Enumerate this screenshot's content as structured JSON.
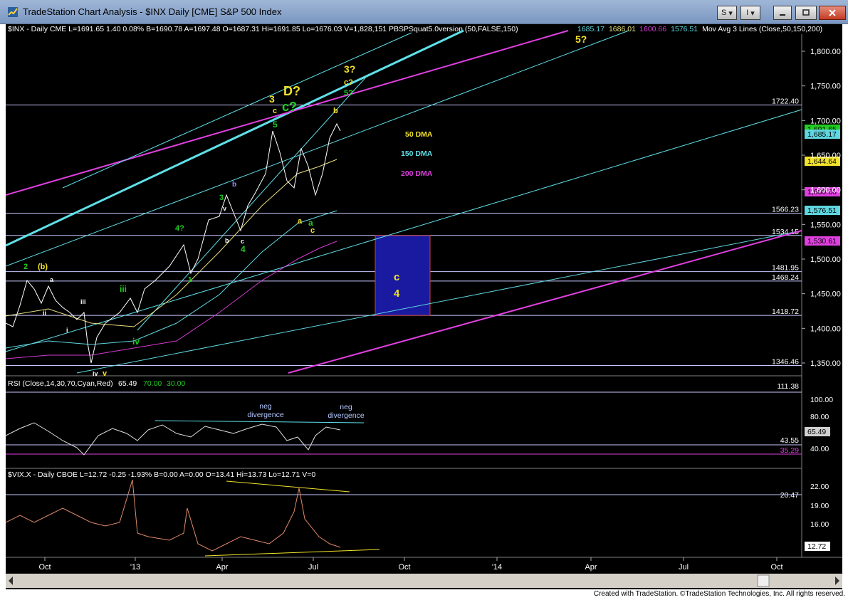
{
  "window": {
    "title": "TradeStation Chart Analysis - $INX Daily [CME] S&P 500 Index",
    "buttons": {
      "s": "S",
      "i": "I"
    }
  },
  "colors": {
    "price": "#ffffff",
    "ma50": "#e8e080",
    "ma150": "#5fd6e0",
    "ma200": "#d23bd2",
    "rsi": "#e0e0e0",
    "vix": "#e08a6a",
    "green": "#22cc22",
    "yellow": "#f2e22a",
    "cyan": "#5fe0e8",
    "magenta": "#e040e0",
    "box": "#1a1aa0"
  },
  "price_pane": {
    "header": "$INX - Daily  CME  L=1691.65  1.40  0.08%  B=1690.78  A=1697.48  O=1687.31  Hi=1691.85  Lo=1676.03  V=1,828,151  PBSPSquat5.0version (50,FALSE,150)",
    "header_extra": [
      {
        "text": "1685.17",
        "color": "#5fd6e0"
      },
      {
        "text": "1686.01",
        "color": "#e8e080"
      },
      {
        "text": "1600.66",
        "color": "#d23bd2"
      },
      {
        "text": "1576.51",
        "color": "#5fd6e0"
      },
      {
        "text": "Mov Avg 3 Lines (Close,50,150,200)",
        "color": "#ffffff"
      }
    ],
    "axis_ticks": [
      "1,800.00",
      "1,750.00",
      "1,700.00",
      "1,650.00",
      "1,600.00",
      "1,550.00",
      "1,500.00",
      "1,450.00",
      "1,400.00",
      "1,350.00"
    ],
    "level_lines": [
      {
        "label": "1722.40"
      },
      {
        "label": "1566.23"
      },
      {
        "label": "1534.15"
      },
      {
        "label": "1481.95"
      },
      {
        "label": "1468.24"
      },
      {
        "label": "1418.72"
      },
      {
        "label": "1346.46"
      }
    ],
    "tags": [
      {
        "text": "1,691.65",
        "bg": "#22cc22"
      },
      {
        "text": "1,685.17",
        "bg": "#5fd6e0"
      },
      {
        "text": "1,644.64",
        "bg": "#f2e22a"
      },
      {
        "text": "1,600.66",
        "bg": "#e040e0"
      },
      {
        "text": "1,576.51",
        "bg": "#5fd6e0"
      },
      {
        "text": "1,530.61",
        "bg": "#e040e0"
      }
    ],
    "legend": {
      "dma50": "50 DMA",
      "dma150": "150 DMA",
      "dma200": "200 DMA"
    },
    "wave_labels": [
      "5?",
      "3?",
      "c?",
      "5?",
      "D?",
      "c?",
      "3",
      "c",
      "5",
      "b",
      "3",
      "v",
      "b",
      "a",
      "c",
      "4",
      "a",
      "4?",
      "iii",
      "1",
      "iv",
      "2",
      "(b)",
      "a",
      "ii",
      "i",
      "iii",
      "iv",
      "v",
      "b",
      "c",
      "4"
    ]
  },
  "rsi_pane": {
    "header": "RSI (Close,14,30,70,Cyan,Red)",
    "value": "65.49",
    "levels_label": [
      "70.00",
      "30.00"
    ],
    "axis_ticks": [
      "111.38",
      "100.00",
      "80.00",
      "60.00",
      "43.55",
      "40.00",
      "35.29"
    ],
    "annotations": [
      {
        "text": [
          "neg",
          "divergence"
        ]
      },
      {
        "text": [
          "neg",
          "divergence"
        ]
      }
    ],
    "tag": "65.49"
  },
  "vix_pane": {
    "header": "$VIX.X - Daily  CBOE  L=12.72  -0.25  -1.93%  B=0.00  A=0.00  O=13.41  Hi=13.73  Lo=12.71  V=0",
    "axis_ticks": [
      "22.00",
      "20.47",
      "19.00",
      "16.00",
      "13.00"
    ],
    "tag": "12.72"
  },
  "x_axis": {
    "labels": [
      "Oct",
      "'13",
      "Apr",
      "Jul",
      "Oct",
      "'14",
      "Apr",
      "Jul",
      "Oct"
    ]
  },
  "footer": "Created with TradeStation. ©TradeStation Technologies, Inc. All rights reserved."
}
